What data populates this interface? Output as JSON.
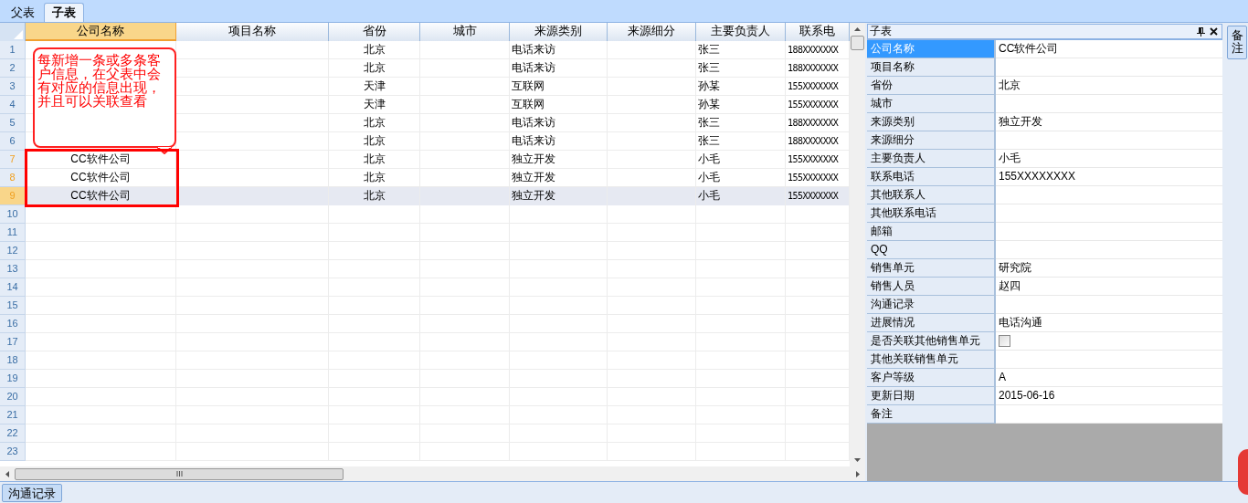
{
  "tabs": [
    {
      "label": "父表",
      "selected": false
    },
    {
      "label": "子表",
      "selected": true
    }
  ],
  "grid": {
    "columns": [
      {
        "label": "公司名称",
        "selected": true
      },
      {
        "label": "项目名称",
        "selected": false
      },
      {
        "label": "省份",
        "selected": false
      },
      {
        "label": "城市",
        "selected": false
      },
      {
        "label": "来源类别",
        "selected": false
      },
      {
        "label": "来源细分",
        "selected": false
      },
      {
        "label": "主要负责人",
        "selected": false
      },
      {
        "label": "联系电",
        "selected": false
      }
    ],
    "rows": [
      {
        "number": "1",
        "selected": false,
        "focused": false,
        "cells": [
          null,
          null,
          "北京",
          null,
          "电话来访",
          null,
          "张三",
          "188XXXXXXX"
        ]
      },
      {
        "number": "2",
        "selected": false,
        "focused": false,
        "cells": [
          null,
          null,
          "北京",
          null,
          "电话来访",
          null,
          "张三",
          "188XXXXXXX"
        ]
      },
      {
        "number": "3",
        "selected": false,
        "focused": false,
        "cells": [
          null,
          null,
          "天津",
          null,
          "互联网",
          null,
          "孙某",
          "155XXXXXXX"
        ]
      },
      {
        "number": "4",
        "selected": false,
        "focused": false,
        "cells": [
          null,
          null,
          "天津",
          null,
          "互联网",
          null,
          "孙某",
          "155XXXXXXX"
        ]
      },
      {
        "number": "5",
        "selected": false,
        "focused": false,
        "cells": [
          null,
          null,
          "北京",
          null,
          "电话来访",
          null,
          "张三",
          "188XXXXXXX"
        ]
      },
      {
        "number": "6",
        "selected": false,
        "focused": false,
        "cells": [
          null,
          null,
          "北京",
          null,
          "电话来访",
          null,
          "张三",
          "188XXXXXXX"
        ]
      },
      {
        "number": "7",
        "selected": true,
        "focused": false,
        "cells": [
          "CC软件公司",
          null,
          "北京",
          null,
          "独立开发",
          null,
          "小毛",
          "155XXXXXXX"
        ]
      },
      {
        "number": "8",
        "selected": true,
        "focused": false,
        "cells": [
          "CC软件公司",
          null,
          "北京",
          null,
          "独立开发",
          null,
          "小毛",
          "155XXXXXXX"
        ]
      },
      {
        "number": "9",
        "selected": true,
        "focused": true,
        "cells": [
          "CC软件公司",
          null,
          "北京",
          null,
          "独立开发",
          null,
          "小毛",
          "155XXXXXXX"
        ]
      },
      {
        "number": "10",
        "selected": false,
        "focused": false
      },
      {
        "number": "11",
        "selected": false,
        "focused": false
      },
      {
        "number": "12",
        "selected": false,
        "focused": false
      },
      {
        "number": "13",
        "selected": false,
        "focused": false
      },
      {
        "number": "14",
        "selected": false,
        "focused": false
      },
      {
        "number": "15",
        "selected": false,
        "focused": false
      },
      {
        "number": "16",
        "selected": false,
        "focused": false
      },
      {
        "number": "17",
        "selected": false,
        "focused": false
      },
      {
        "number": "18",
        "selected": false,
        "focused": false
      },
      {
        "number": "19",
        "selected": false,
        "focused": false
      },
      {
        "number": "20",
        "selected": false,
        "focused": false
      },
      {
        "number": "21",
        "selected": false,
        "focused": false
      },
      {
        "number": "22",
        "selected": false,
        "focused": false
      },
      {
        "number": "23",
        "selected": false,
        "focused": false
      }
    ]
  },
  "callout": {
    "text": "每新增一条或多条客户信息，在父表中会有对应的信息出现，并且可以关联查看"
  },
  "detail_panel": {
    "title": "子表",
    "properties": [
      {
        "label": "公司名称",
        "value": "CC软件公司",
        "kind": "text",
        "selected": true
      },
      {
        "label": "项目名称",
        "kind": "text",
        "selected": false
      },
      {
        "label": "省份",
        "value": "北京",
        "kind": "text",
        "selected": false
      },
      {
        "label": "城市",
        "kind": "text",
        "selected": false
      },
      {
        "label": "来源类别",
        "value": "独立开发",
        "kind": "text",
        "selected": false
      },
      {
        "label": "来源细分",
        "kind": "text",
        "selected": false
      },
      {
        "label": "主要负责人",
        "value": "小毛",
        "kind": "text",
        "selected": false
      },
      {
        "label": "联系电话",
        "value": "155XXXXXXXX",
        "kind": "text",
        "selected": false
      },
      {
        "label": "其他联系人",
        "kind": "text",
        "selected": false
      },
      {
        "label": "其他联系电话",
        "kind": "text",
        "selected": false
      },
      {
        "label": "邮箱",
        "kind": "text",
        "selected": false
      },
      {
        "label": "QQ",
        "kind": "text",
        "selected": false
      },
      {
        "label": "销售单元",
        "value": "研究院",
        "kind": "text",
        "selected": false
      },
      {
        "label": "销售人员",
        "value": "赵四",
        "kind": "text",
        "selected": false
      },
      {
        "label": "沟通记录",
        "kind": "text",
        "selected": false
      },
      {
        "label": "进展情况",
        "value": "电话沟通",
        "kind": "text",
        "selected": false
      },
      {
        "label": "是否关联其他销售单元",
        "kind": "checkbox",
        "checked": false,
        "selected": false
      },
      {
        "label": "其他关联销售单元",
        "kind": "text",
        "selected": false
      },
      {
        "label": "客户等级",
        "value": "A",
        "kind": "text",
        "selected": false
      },
      {
        "label": "更新日期",
        "value": "2015-06-16",
        "kind": "text",
        "selected": false
      },
      {
        "label": "备注",
        "kind": "text",
        "selected": false
      }
    ]
  },
  "side_tabs": [
    "备注"
  ],
  "bottom_tabs": [
    "沟通记录"
  ]
}
